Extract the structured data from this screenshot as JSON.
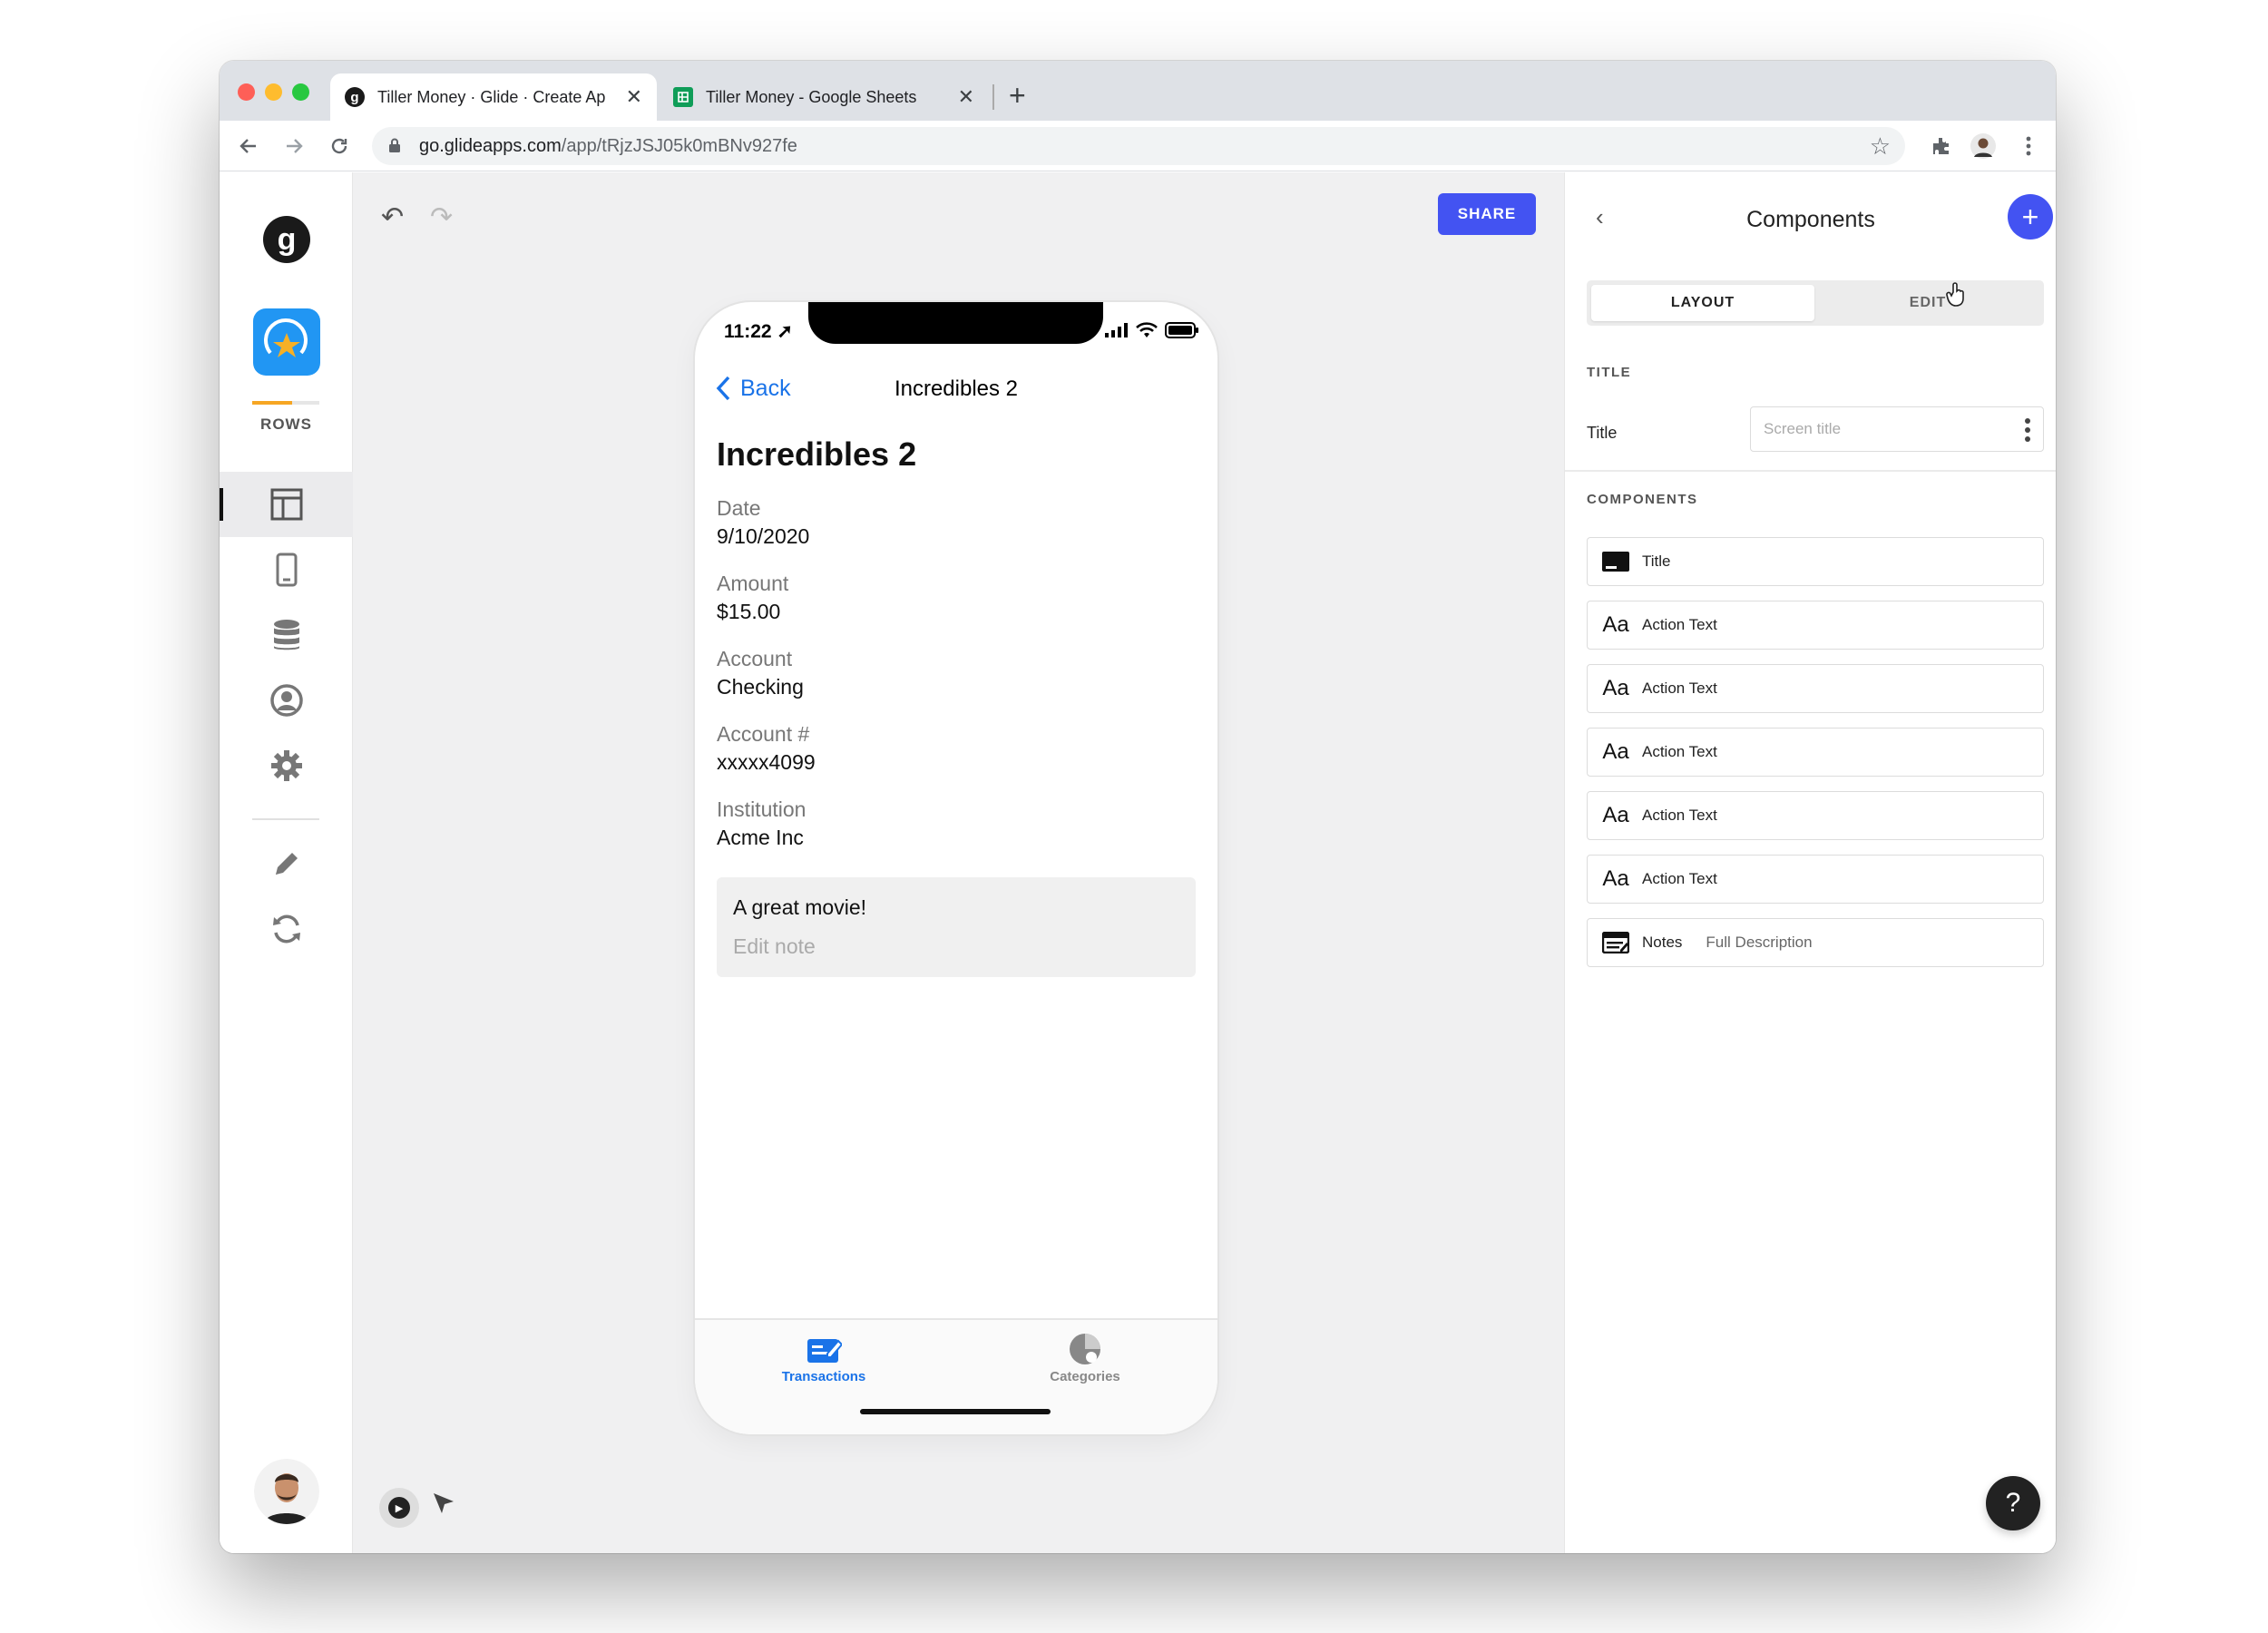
{
  "browser": {
    "tabs": [
      {
        "title": "Tiller Money · Glide · Create Ap",
        "favicon": "glide-g-icon",
        "active": true
      },
      {
        "title": "Tiller Money - Google Sheets",
        "favicon": "google-sheets-icon",
        "active": false
      }
    ],
    "close_glyph": "✕",
    "new_tab_glyph": "+",
    "url_host": "go.glideapps.com",
    "url_path": "/app/tRjzJSJ05k0mBNv927fe"
  },
  "left_nav": {
    "logo_letter": "g",
    "rows_label": "ROWS",
    "items": [
      "layout-icon",
      "phone-icon",
      "database-icon",
      "user-circle-icon",
      "gear-icon",
      "pencil-icon",
      "sync-icon"
    ]
  },
  "canvas": {
    "share_label": "SHARE"
  },
  "phone": {
    "time": "11:22",
    "back_label": "Back",
    "nav_title": "Incredibles 2",
    "screen_title": "Incredibles 2",
    "fields": [
      {
        "label": "Date",
        "value": "9/10/2020"
      },
      {
        "label": "Amount",
        "value": "$15.00"
      },
      {
        "label": "Account",
        "value": "Checking"
      },
      {
        "label": "Account #",
        "value": "xxxxx4099"
      },
      {
        "label": "Institution",
        "value": "Acme Inc"
      }
    ],
    "note_text": "A great movie!",
    "note_edit": "Edit note",
    "tabs": [
      {
        "label": "Transactions",
        "active": true
      },
      {
        "label": "Categories",
        "active": false
      }
    ]
  },
  "panel": {
    "back_glyph": "‹",
    "title": "Components",
    "add_glyph": "+",
    "segments": {
      "layout": "LAYOUT",
      "edit": "EDIT"
    },
    "title_section": "TITLE",
    "title_label": "Title",
    "title_placeholder": "Screen title",
    "components_section": "COMPONENTS",
    "components": [
      {
        "icon": "title-component-icon",
        "glyph": "",
        "name": "Title",
        "sub": ""
      },
      {
        "icon": "text-aa-icon",
        "glyph": "Aa",
        "name": "Action Text",
        "sub": ""
      },
      {
        "icon": "text-aa-icon",
        "glyph": "Aa",
        "name": "Action Text",
        "sub": ""
      },
      {
        "icon": "text-aa-icon",
        "glyph": "Aa",
        "name": "Action Text",
        "sub": ""
      },
      {
        "icon": "text-aa-icon",
        "glyph": "Aa",
        "name": "Action Text",
        "sub": ""
      },
      {
        "icon": "text-aa-icon",
        "glyph": "Aa",
        "name": "Action Text",
        "sub": ""
      },
      {
        "icon": "notes-component-icon",
        "glyph": "",
        "name": "Notes",
        "sub": "Full Description"
      }
    ],
    "help_glyph": "?"
  },
  "colors": {
    "accent": "#4353f2",
    "ios_blue": "#1a73e8",
    "rows_progress": "#f6a623"
  }
}
